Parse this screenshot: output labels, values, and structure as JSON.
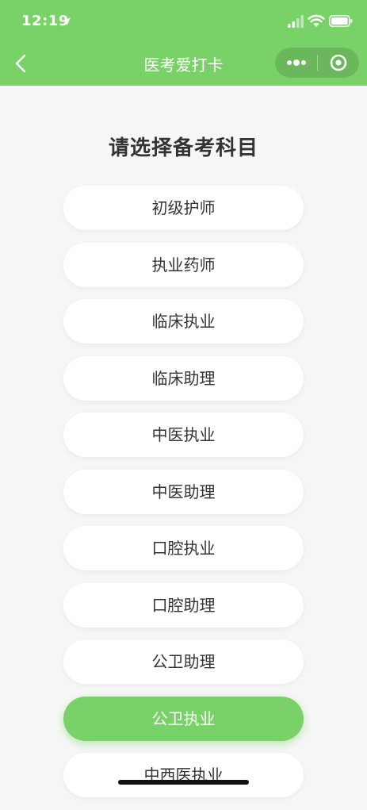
{
  "status_bar": {
    "time": "12:19"
  },
  "nav": {
    "title": "医考爱打卡",
    "back_icon": "chevron-left-icon",
    "more_icon": "more-dots-icon",
    "close_icon": "target-circle-icon"
  },
  "page": {
    "heading": "请选择备考科目"
  },
  "subjects": [
    {
      "label": "初级护师",
      "selected": false
    },
    {
      "label": "执业药师",
      "selected": false
    },
    {
      "label": "临床执业",
      "selected": false
    },
    {
      "label": "临床助理",
      "selected": false
    },
    {
      "label": "中医执业",
      "selected": false
    },
    {
      "label": "中医助理",
      "selected": false
    },
    {
      "label": "口腔执业",
      "selected": false
    },
    {
      "label": "口腔助理",
      "selected": false
    },
    {
      "label": "公卫助理",
      "selected": false
    },
    {
      "label": "公卫执业",
      "selected": true
    },
    {
      "label": "中西医执业",
      "selected": false
    }
  ],
  "colors": {
    "brand_green": "#79d268",
    "background": "#f6f6f6",
    "button_bg": "#ffffff",
    "text_dark": "#333333"
  }
}
